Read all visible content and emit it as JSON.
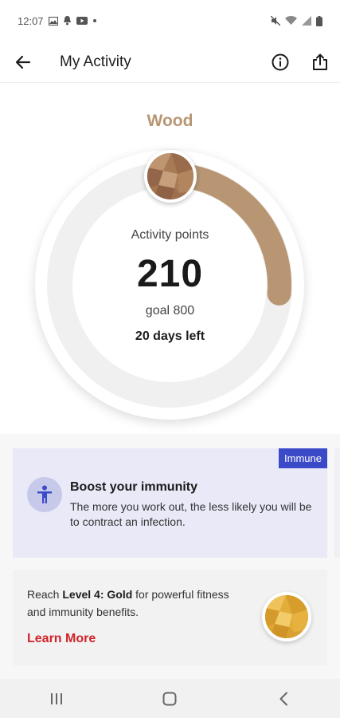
{
  "status_bar": {
    "time": "12:07",
    "left_icons": [
      "image-icon",
      "notification-icon",
      "youtube-icon",
      "dot-icon"
    ],
    "right_icons": [
      "mute-icon",
      "wifi-icon",
      "signal-icon",
      "battery-icon"
    ]
  },
  "app_bar": {
    "title": "My Activity",
    "icons": [
      "back-arrow-icon",
      "info-icon",
      "share-icon"
    ]
  },
  "level": {
    "name": "Wood",
    "points_label": "Activity points",
    "points": "210",
    "goal": "goal 800",
    "days_left": "20 days left",
    "progress_fraction": 0.2625,
    "accent_color": "#b89673"
  },
  "immune_card": {
    "tag": "Immune",
    "title": "Boost your immunity",
    "description": "The more you work out, the less likely you will be to contract an infection.",
    "icon": "person-icon"
  },
  "level_card": {
    "prefix": "Reach ",
    "level": "Level 4: Gold",
    "suffix": " for powerful fitness and immunity benefits.",
    "link": "Learn More",
    "link_color": "#d0232a"
  },
  "nav_bar": {
    "icons": [
      "recent-apps-icon",
      "home-icon",
      "back-icon"
    ]
  }
}
